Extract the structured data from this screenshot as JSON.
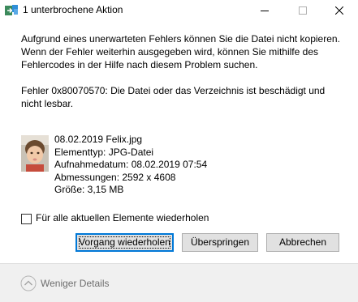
{
  "window": {
    "title": "1 unterbrochene Aktion",
    "controls": {
      "minimize": "minimize-icon",
      "maximize": "maximize-icon",
      "close": "close-icon"
    }
  },
  "message": {
    "main": "Aufgrund eines unerwarteten Fehlers können Sie die Datei nicht kopieren. Wenn der Fehler weiterhin ausgegeben wird, können Sie mithilfe des Fehlercodes in der Hilfe nach diesem Problem suchen.",
    "error": "Fehler 0x80070570: Die Datei oder das Verzeichnis ist beschädigt und nicht lesbar."
  },
  "file": {
    "name": "08.02.2019 Felix.jpg",
    "type": "Elementtyp: JPG-Datei",
    "date": "Aufnahmedatum: 08.02.2019 07:54",
    "dimensions": "Abmessungen: 2592 x 4608",
    "size": "Größe: 3,15 MB"
  },
  "repeat_checkbox": {
    "label": "Für alle aktuellen Elemente wiederholen",
    "checked": false
  },
  "buttons": {
    "retry": "Vorgang wiederholen",
    "skip": "Überspringen",
    "cancel": "Abbrechen"
  },
  "footer": {
    "less_details": "Weniger Details"
  },
  "colors": {
    "focus_border": "#0078d7",
    "button_bg": "#e1e1e1",
    "footer_bg": "#f0f0f0"
  }
}
